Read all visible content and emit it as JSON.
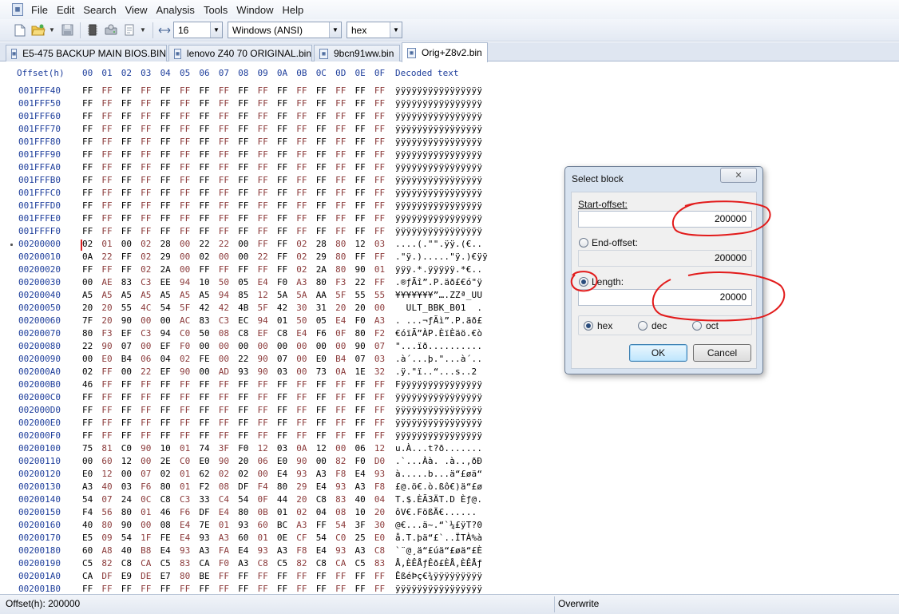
{
  "menu": {
    "app_icon": "hex-app-icon",
    "items": [
      "File",
      "Edit",
      "Search",
      "View",
      "Analysis",
      "Tools",
      "Window",
      "Help"
    ]
  },
  "toolbar": {
    "bytes_per_row": "16",
    "charset": "Windows (ANSI)",
    "display_mode": "hex"
  },
  "tabs": [
    {
      "label": "E5-475 BACKUP MAIN BIOS.BIN",
      "active": false
    },
    {
      "label": "lenovo Z40 70 ORIGINAL.bin",
      "active": false
    },
    {
      "label": "9bcn91ww.bin",
      "active": false
    },
    {
      "label": "Orig+Z8v2.bin",
      "active": true
    }
  ],
  "hex": {
    "offset_header": "Offset(h)",
    "column_headers": [
      "00",
      "01",
      "02",
      "03",
      "04",
      "05",
      "06",
      "07",
      "08",
      "09",
      "0A",
      "0B",
      "0C",
      "0D",
      "0E",
      "0F"
    ],
    "decoded_header": "Decoded text",
    "rows": [
      {
        "offset": "001FFF40",
        "bytes": "FF FF FF FF FF FF FF FF FF FF FF FF FF FF FF FF",
        "text": "ÿÿÿÿÿÿÿÿÿÿÿÿÿÿÿÿ"
      },
      {
        "offset": "001FFF50",
        "bytes": "FF FF FF FF FF FF FF FF FF FF FF FF FF FF FF FF",
        "text": "ÿÿÿÿÿÿÿÿÿÿÿÿÿÿÿÿ"
      },
      {
        "offset": "001FFF60",
        "bytes": "FF FF FF FF FF FF FF FF FF FF FF FF FF FF FF FF",
        "text": "ÿÿÿÿÿÿÿÿÿÿÿÿÿÿÿÿ"
      },
      {
        "offset": "001FFF70",
        "bytes": "FF FF FF FF FF FF FF FF FF FF FF FF FF FF FF FF",
        "text": "ÿÿÿÿÿÿÿÿÿÿÿÿÿÿÿÿ"
      },
      {
        "offset": "001FFF80",
        "bytes": "FF FF FF FF FF FF FF FF FF FF FF FF FF FF FF FF",
        "text": "ÿÿÿÿÿÿÿÿÿÿÿÿÿÿÿÿ"
      },
      {
        "offset": "001FFF90",
        "bytes": "FF FF FF FF FF FF FF FF FF FF FF FF FF FF FF FF",
        "text": "ÿÿÿÿÿÿÿÿÿÿÿÿÿÿÿÿ"
      },
      {
        "offset": "001FFFA0",
        "bytes": "FF FF FF FF FF FF FF FF FF FF FF FF FF FF FF FF",
        "text": "ÿÿÿÿÿÿÿÿÿÿÿÿÿÿÿÿ"
      },
      {
        "offset": "001FFFB0",
        "bytes": "FF FF FF FF FF FF FF FF FF FF FF FF FF FF FF FF",
        "text": "ÿÿÿÿÿÿÿÿÿÿÿÿÿÿÿÿ"
      },
      {
        "offset": "001FFFC0",
        "bytes": "FF FF FF FF FF FF FF FF FF FF FF FF FF FF FF FF",
        "text": "ÿÿÿÿÿÿÿÿÿÿÿÿÿÿÿÿ"
      },
      {
        "offset": "001FFFD0",
        "bytes": "FF FF FF FF FF FF FF FF FF FF FF FF FF FF FF FF",
        "text": "ÿÿÿÿÿÿÿÿÿÿÿÿÿÿÿÿ"
      },
      {
        "offset": "001FFFE0",
        "bytes": "FF FF FF FF FF FF FF FF FF FF FF FF FF FF FF FF",
        "text": "ÿÿÿÿÿÿÿÿÿÿÿÿÿÿÿÿ"
      },
      {
        "offset": "001FFFF0",
        "bytes": "FF FF FF FF FF FF FF FF FF FF FF FF FF FF FF FF",
        "text": "ÿÿÿÿÿÿÿÿÿÿÿÿÿÿÿÿ"
      },
      {
        "offset": "00200000",
        "bytes": "02 01 00 02 28 00 22 22 00 FF FF 02 28 80 12 03",
        "text": "....(.\"\".ÿÿ.(€.."
      },
      {
        "offset": "00200010",
        "bytes": "0A 22 FF 02 29 00 02 00 00 22 FF 02 29 80 FF FF",
        "text": ".\"ÿ.).....\"ÿ.)€ÿÿ"
      },
      {
        "offset": "00200020",
        "bytes": "FF FF FF 02 2A 00 FF FF FF FF FF 02 2A 80 90 01",
        "text": "ÿÿÿ.*.ÿÿÿÿÿ.*€.."
      },
      {
        "offset": "00200030",
        "bytes": "00 AE 83 C3 EE 94 10 50 05 E4 F0 A3 80 F3 22 FF",
        "text": ".®ƒÃî”.P.äð£€ó\"ÿ"
      },
      {
        "offset": "00200040",
        "bytes": "A5 A5 A5 A5 A5 A5 A5 94 85 12 5A 5A AA 5F 55 55",
        "text": "¥¥¥¥¥¥¥”….ZZª_UU"
      },
      {
        "offset": "00200050",
        "bytes": "20 20 55 4C 54 5F 42 42 4B 5F 42 30 31 20 20 00",
        "text": "  ULT_BBK_B01  ."
      },
      {
        "offset": "00200060",
        "bytes": "7F 20 90 00 00 AC 83 C3 EC 94 01 50 05 E4 F0 A3",
        "text": ". ...¬ƒÃì”.P.äð£"
      },
      {
        "offset": "00200070",
        "bytes": "80 F3 EF C3 94 C0 50 08 C8 EF C8 E4 F6 0F 80 F2",
        "text": "€óïÃ”ÀP.ÈïÈäö.€ò"
      },
      {
        "offset": "00200080",
        "bytes": "22 90 07 00 EF F0 00 00 00 00 00 00 00 00 90 07",
        "text": "\"...ïð.........."
      },
      {
        "offset": "00200090",
        "bop": "",
        "bytes": "00 E0 B4 06 04 02 FE 00 22 90 07 00 E0 B4 07 03",
        "text": ".à´...þ.\"...à´.."
      },
      {
        "offset": "002000A0",
        "bytes": "02 FF 00 22 EF 90 00 AD 93 90 03 00 73 0A 1E 32",
        "text": ".ÿ.\"ï..­“...s..2"
      },
      {
        "offset": "002000B0",
        "bytes": "46 FF FF FF FF FF FF FF FF FF FF FF FF FF FF FF",
        "text": "Fÿÿÿÿÿÿÿÿÿÿÿÿÿÿÿ"
      },
      {
        "offset": "002000C0",
        "bytes": "FF FF FF FF FF FF FF FF FF FF FF FF FF FF FF FF",
        "text": "ÿÿÿÿÿÿÿÿÿÿÿÿÿÿÿÿ"
      },
      {
        "offset": "002000D0",
        "bytes": "FF FF FF FF FF FF FF FF FF FF FF FF FF FF FF FF",
        "text": "ÿÿÿÿÿÿÿÿÿÿÿÿÿÿÿÿ"
      },
      {
        "offset": "002000E0",
        "bytes": "FF FF FF FF FF FF FF FF FF FF FF FF FF FF FF FF",
        "text": "ÿÿÿÿÿÿÿÿÿÿÿÿÿÿÿÿ"
      },
      {
        "offset": "002000F0",
        "bytes": "FF FF FF FF FF FF FF FF FF FF FF FF FF FF FF FF",
        "text": "ÿÿÿÿÿÿÿÿÿÿÿÿÿÿÿÿ"
      },
      {
        "offset": "00200100",
        "bytes": "75 81 C0 90 10 01 74 3F F0 12 03 0A 12 00 06 12",
        "text": "u.À...t?ð......."
      },
      {
        "offset": "00200110",
        "bytes": "00 60 12 00 2E C0 E0 90 20 06 E0 90 00 82 F0 D0",
        "text": ".`...Àà. .à..‚ðÐ"
      },
      {
        "offset": "00200120",
        "bytes": "E0 12 00 07 02 01 62 02 02 00 E4 93 A3 F8 E4 93",
        "text": "à.....b...ä“£øä“"
      },
      {
        "offset": "00200130",
        "bytes": "A3 40 03 F6 80 01 F2 08 DF F4 80 29 E4 93 A3 F8",
        "text": "£@.ö€.ò.ßô€)ä“£ø"
      },
      {
        "offset": "00200140",
        "bytes": "54 07 24 0C C8 C3 33 C4 54 0F 44 20 C8 83 40 04",
        "text": "T.$.ÈÃ3ÄT.D Èƒ@."
      },
      {
        "offset": "00200150",
        "bytes": "F4 56 80 01 46 F6 DF E4 80 0B 01 02 04 08 10 20",
        "text": "ôV€.FößÄ€...... "
      },
      {
        "offset": "00200160",
        "bytes": "40 80 90 00 08 E4 7E 01 93 60 BC A3 FF 54 3F 30",
        "text": "@€...ä~.“`¼£ÿT?0"
      },
      {
        "offset": "00200170",
        "bytes": "E5 09 54 1F FE E4 93 A3 60 01 0E CF 54 C0 25 E0",
        "text": "å.T.þä“£`..ÏTÀ%à"
      },
      {
        "offset": "00200180",
        "bytes": "60 A8 40 B8 E4 93 A3 FA E4 93 A3 F8 E4 93 A3 C8",
        "text": "`¨@¸ä“£úä“£øä“£È"
      },
      {
        "offset": "00200190",
        "bytes": "C5 82 C8 CA C5 83 CA F0 A3 C8 C5 82 C8 CA C5 83",
        "text": "Å‚ÈÊÅƒÊð£ÈÅ‚ÈÊÅƒ"
      },
      {
        "offset": "002001A0",
        "bytes": "CA DF E9 DE E7 80 BE FF FF FF FF FF FF FF FF FF",
        "text": "ÊßéÞç€¾ÿÿÿÿÿÿÿÿÿ"
      },
      {
        "offset": "002001B0",
        "bytes": "FF FF FF FF FF FF FF FF FF FF FF FF FF FF FF FF",
        "text": "ÿÿÿÿÿÿÿÿÿÿÿÿÿÿÿÿ"
      }
    ]
  },
  "status": {
    "offset": "Offset(h): 200000",
    "mode": "Overwrite"
  },
  "dialog": {
    "title": "Select block",
    "start_label": "Start-offset:",
    "start_value": "200000",
    "end_label": "End-offset:",
    "end_value": "200000",
    "end_selected": false,
    "length_label": "Length:",
    "length_value": "20000",
    "length_selected": true,
    "base_options": [
      {
        "label": "hex",
        "selected": true
      },
      {
        "label": "dec",
        "selected": false
      },
      {
        "label": "oct",
        "selected": false
      }
    ],
    "ok_label": "OK",
    "cancel_label": "Cancel",
    "close_glyph": "✕"
  },
  "colors": {
    "offset_blue": "#1f3f9c",
    "odd_column": "#8b3a3a",
    "annotation_red": "#e21b1b"
  }
}
